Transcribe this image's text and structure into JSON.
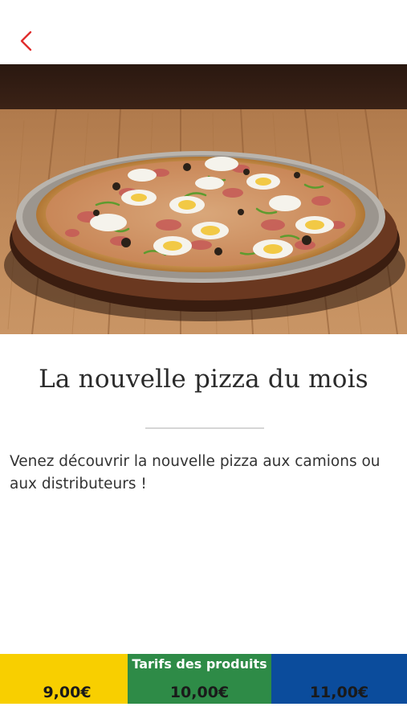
{
  "header": {
    "back_icon": "chevron-left-icon",
    "back_color": "#e02d2d"
  },
  "hero": {
    "image": "pizza-photo"
  },
  "article": {
    "title": "La nouvelle pizza du mois",
    "description": "Venez découvrir la nouvelle pizza aux camions ou aux distributeurs !"
  },
  "pricing": {
    "label": "Tarifs des produits",
    "items": [
      {
        "price": "9,00€",
        "color": "#f8cf00"
      },
      {
        "price": "10,00€",
        "color": "#2e8b47"
      },
      {
        "price": "11,00€",
        "color": "#0b4c9c"
      }
    ]
  }
}
